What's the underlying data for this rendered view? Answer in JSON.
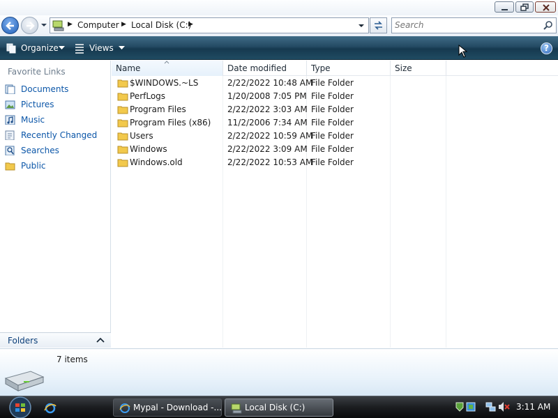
{
  "window": {
    "minimize_icon": "minimize-icon",
    "maximize_icon": "maximize-icon",
    "close_icon": "close-icon"
  },
  "address": {
    "crumbs": [
      "Computer",
      "Local Disk (C:)"
    ],
    "search_placeholder": "Search"
  },
  "toolbar": {
    "organize_label": "Organize",
    "views_label": "Views"
  },
  "sidebar": {
    "favorites_title": "Favorite Links",
    "items": [
      {
        "label": "Documents",
        "icon": "documents-icon"
      },
      {
        "label": "Pictures",
        "icon": "pictures-icon"
      },
      {
        "label": "Music",
        "icon": "music-icon"
      },
      {
        "label": "Recently Changed",
        "icon": "recently-changed-icon"
      },
      {
        "label": "Searches",
        "icon": "searches-icon"
      },
      {
        "label": "Public",
        "icon": "folder-icon"
      }
    ],
    "folders_label": "Folders"
  },
  "columns": [
    "Name",
    "Date modified",
    "Type",
    "Size"
  ],
  "files": [
    {
      "name": "$WINDOWS.~LS",
      "date": "2/22/2022 10:48 AM",
      "type": "File Folder",
      "size": ""
    },
    {
      "name": "PerfLogs",
      "date": "1/20/2008 7:05 PM",
      "type": "File Folder",
      "size": ""
    },
    {
      "name": "Program Files",
      "date": "2/22/2022 3:03 AM",
      "type": "File Folder",
      "size": ""
    },
    {
      "name": "Program Files (x86)",
      "date": "11/2/2006 7:34 AM",
      "type": "File Folder",
      "size": ""
    },
    {
      "name": "Users",
      "date": "2/22/2022 10:59 AM",
      "type": "File Folder",
      "size": ""
    },
    {
      "name": "Windows",
      "date": "2/22/2022 3:09 AM",
      "type": "File Folder",
      "size": ""
    },
    {
      "name": "Windows.old",
      "date": "2/22/2022 10:53 AM",
      "type": "File Folder",
      "size": ""
    }
  ],
  "details": {
    "item_count": "7 items"
  },
  "taskbar": {
    "tasks": [
      {
        "label": "Mypal - Download -...",
        "icon": "browser-icon"
      },
      {
        "label": "Local Disk (C:)",
        "icon": "drive-icon"
      }
    ],
    "clock": "3:11 AM"
  },
  "colors": {
    "accent": "#0b56a8",
    "command_bar": "#244a63",
    "folder": "#f2c94c"
  }
}
